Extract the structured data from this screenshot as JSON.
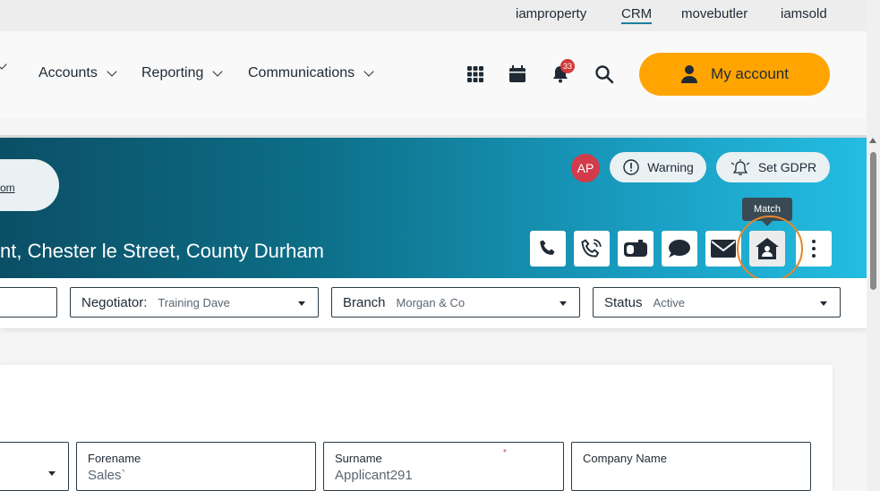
{
  "brands": [
    "iamproperty",
    "CRM",
    "movebutler",
    "iamsold"
  ],
  "brand_active": "CRM",
  "nav": {
    "items": [
      "Accounts",
      "Reporting",
      "Communications"
    ],
    "notification_count": "33",
    "my_account_label": "My account"
  },
  "header": {
    "link_text": "om",
    "address": "nt, Chester le Street, County Durham",
    "avatar_initials": "AP",
    "warning_label": "Warning",
    "gdpr_label": "Set GDPR",
    "tooltip": "Match"
  },
  "filters": {
    "negotiator_label": "Negotiator:",
    "negotiator_value": "Training Dave",
    "branch_label": "Branch",
    "branch_value": "Morgan & Co",
    "status_label": "Status",
    "status_value": "Active"
  },
  "form": {
    "forename_label": "Forename",
    "forename_value": "Sales`",
    "surname_label": "Surname",
    "surname_required": "*",
    "surname_value": "Applicant291",
    "company_label": "Company Name",
    "company_value": ""
  },
  "colors": {
    "accent": "#ffa400",
    "teal_dark": "#0b4f66",
    "teal_light": "#24bde2",
    "highlight_ring": "#e8862b",
    "badge": "#d13a3a"
  }
}
